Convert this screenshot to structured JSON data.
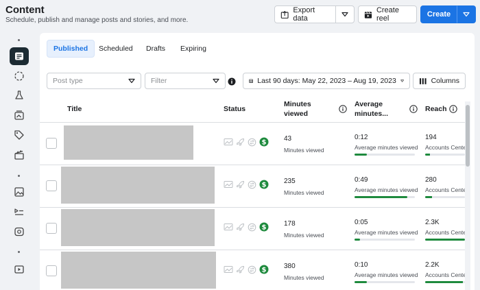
{
  "header": {
    "title": "Content",
    "subtitle": "Schedule, publish and manage posts and stories, and more.",
    "export_label": "Export data",
    "create_reel_label": "Create reel",
    "create_label": "Create"
  },
  "tabs": [
    {
      "label": "Published",
      "active": true
    },
    {
      "label": "Scheduled",
      "active": false
    },
    {
      "label": "Drafts",
      "active": false
    },
    {
      "label": "Expiring",
      "active": false
    }
  ],
  "filters": {
    "post_type_placeholder": "Post type",
    "filter_placeholder": "Filter",
    "date_range": "Last 90 days: May 22, 2023 – Aug 19, 2023",
    "columns_label": "Columns"
  },
  "columns": {
    "title": "Title",
    "status": "Status",
    "minutes_viewed_line1": "Minutes",
    "minutes_viewed_line2": "viewed",
    "avg_minutes_line1": "Average",
    "avg_minutes_line2": "minutes...",
    "reach": "Reach"
  },
  "rows": [
    {
      "minutes": "43",
      "minutes_label": "Minutes viewed",
      "avg": "0:12",
      "avg_label": "Average minutes viewed",
      "avg_fraction": 0.2,
      "reach": "194",
      "reach_label": "Accounts Center",
      "reach_fraction": 0.12
    },
    {
      "minutes": "235",
      "minutes_label": "Minutes viewed",
      "avg": "0:49",
      "avg_label": "Average minutes viewed",
      "avg_fraction": 0.87,
      "reach": "280",
      "reach_label": "Accounts Center",
      "reach_fraction": 0.17
    },
    {
      "minutes": "178",
      "minutes_label": "Minutes viewed",
      "avg": "0:05",
      "avg_label": "Average minutes viewed",
      "avg_fraction": 0.09,
      "reach": "2.3K",
      "reach_label": "Accounts Center",
      "reach_fraction": 1.0
    },
    {
      "minutes": "380",
      "minutes_label": "Minutes viewed",
      "avg": "0:10",
      "avg_label": "Average minutes viewed",
      "avg_fraction": 0.2,
      "reach": "2.2K",
      "reach_label": "Accounts Center",
      "reach_fraction": 0.95
    }
  ],
  "colors": {
    "accent": "#1b74e4",
    "bar": "#1e8a3d",
    "monetized": "#1e8a3d"
  }
}
